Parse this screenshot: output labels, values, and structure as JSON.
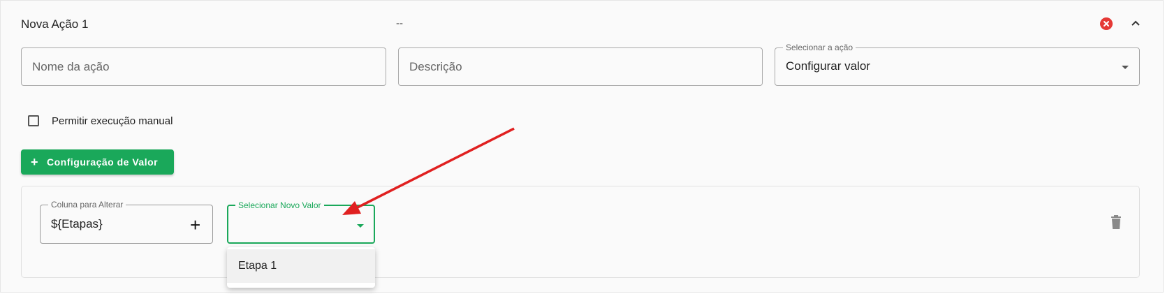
{
  "header": {
    "title": "Nova Ação 1",
    "description": "--",
    "close_icon": "close-circle-icon",
    "collapse_icon": "chevron-up-icon",
    "close_color": "#e53935"
  },
  "form": {
    "name_placeholder": "Nome da ação",
    "description_placeholder": "Descrição",
    "action_select": {
      "label": "Selecionar a ação",
      "value": "Configurar valor"
    }
  },
  "manual_execution": {
    "label": "Permitir execução manual",
    "checked": false
  },
  "add_value_button": {
    "icon": "plus-icon",
    "label": "Configuração de Valor",
    "color": "#1aa85a"
  },
  "value_config": {
    "column": {
      "label": "Coluna para Alterar",
      "value": "${Etapas}"
    },
    "new_value": {
      "label": "Selecionar Novo Valor",
      "value": "",
      "focus_color": "#1aa85a",
      "options": [
        "Etapa 1"
      ]
    },
    "delete_icon": "trash-icon"
  },
  "annotation": {
    "arrow_color": "#e02020"
  }
}
